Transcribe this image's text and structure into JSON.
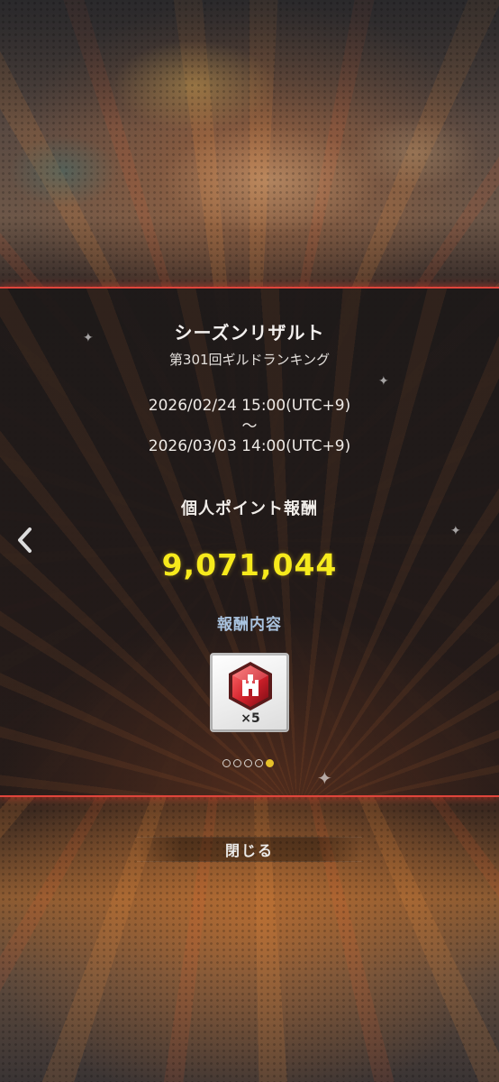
{
  "dialog": {
    "title": "シーズンリザルト",
    "subtitle": "第301回ギルドランキング",
    "period_start": "2026/02/24 15:00(UTC+9)",
    "period_separator": "〜",
    "period_end": "2026/03/03 14:00(UTC+9)",
    "section_label": "個人ポイント報酬",
    "points": "9,071,044",
    "reward_label": "報酬内容",
    "reward_item": {
      "icon": "guild-castle-gem-icon",
      "quantity": "×5"
    },
    "pager": {
      "total": 5,
      "active_index": 4
    }
  },
  "navigation": {
    "previous_icon": "chevron-left-icon"
  },
  "close_button": {
    "label": "閉じる"
  },
  "colors": {
    "accent_red": "#e0453c",
    "points_yellow": "#f6ea1c",
    "reward_label_blue": "#a9c3df",
    "pager_active": "#e7c12a"
  }
}
